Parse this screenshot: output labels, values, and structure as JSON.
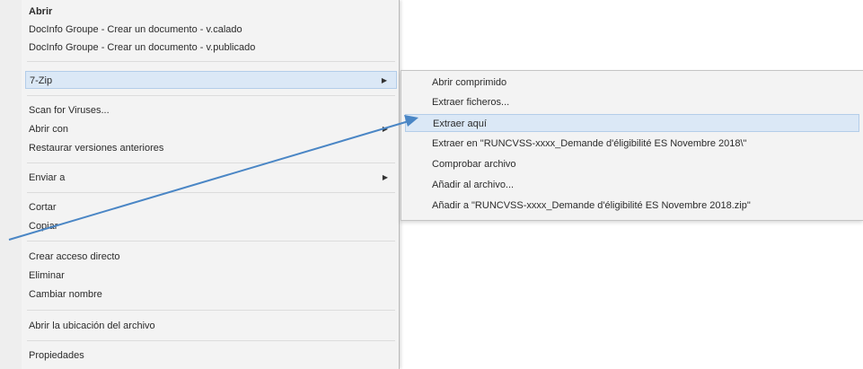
{
  "main_menu": {
    "items": [
      {
        "label": "Abrir",
        "bold": true
      },
      {
        "label": "DocInfo Groupe - Crear un documento - v.calado"
      },
      {
        "label": "DocInfo Groupe - Crear un documento - v.publicado"
      },
      {
        "label": "7-Zip",
        "submenu": true,
        "highlighted": true
      },
      {
        "label": "Scan for Viruses..."
      },
      {
        "label": "Abrir con",
        "submenu": true
      },
      {
        "label": "Restaurar versiones anteriores"
      },
      {
        "label": "Enviar a",
        "submenu": true
      },
      {
        "label": "Cortar"
      },
      {
        "label": "Copiar"
      },
      {
        "label": "Crear acceso directo"
      },
      {
        "label": "Eliminar"
      },
      {
        "label": "Cambiar nombre"
      },
      {
        "label": "Abrir la ubicación del archivo"
      },
      {
        "label": "Propiedades"
      }
    ]
  },
  "sub_menu": {
    "items": [
      {
        "label": "Abrir comprimido"
      },
      {
        "label": "Extraer ficheros..."
      },
      {
        "label": "Extraer aquí",
        "highlighted": true
      },
      {
        "label": "Extraer en \"RUNCVSS-xxxx_Demande d'éligibilité ES Novembre 2018\\\""
      },
      {
        "label": "Comprobar archivo"
      },
      {
        "label": "Añadir al archivo..."
      },
      {
        "label": "Añadir a \"RUNCVSS-xxxx_Demande d'éligibilité ES Novembre 2018.zip\""
      }
    ]
  },
  "icons": {
    "submenu_arrow": "▶"
  },
  "colors": {
    "highlight": "#dbe8f6",
    "annotation_arrow": "#4a86c5"
  }
}
